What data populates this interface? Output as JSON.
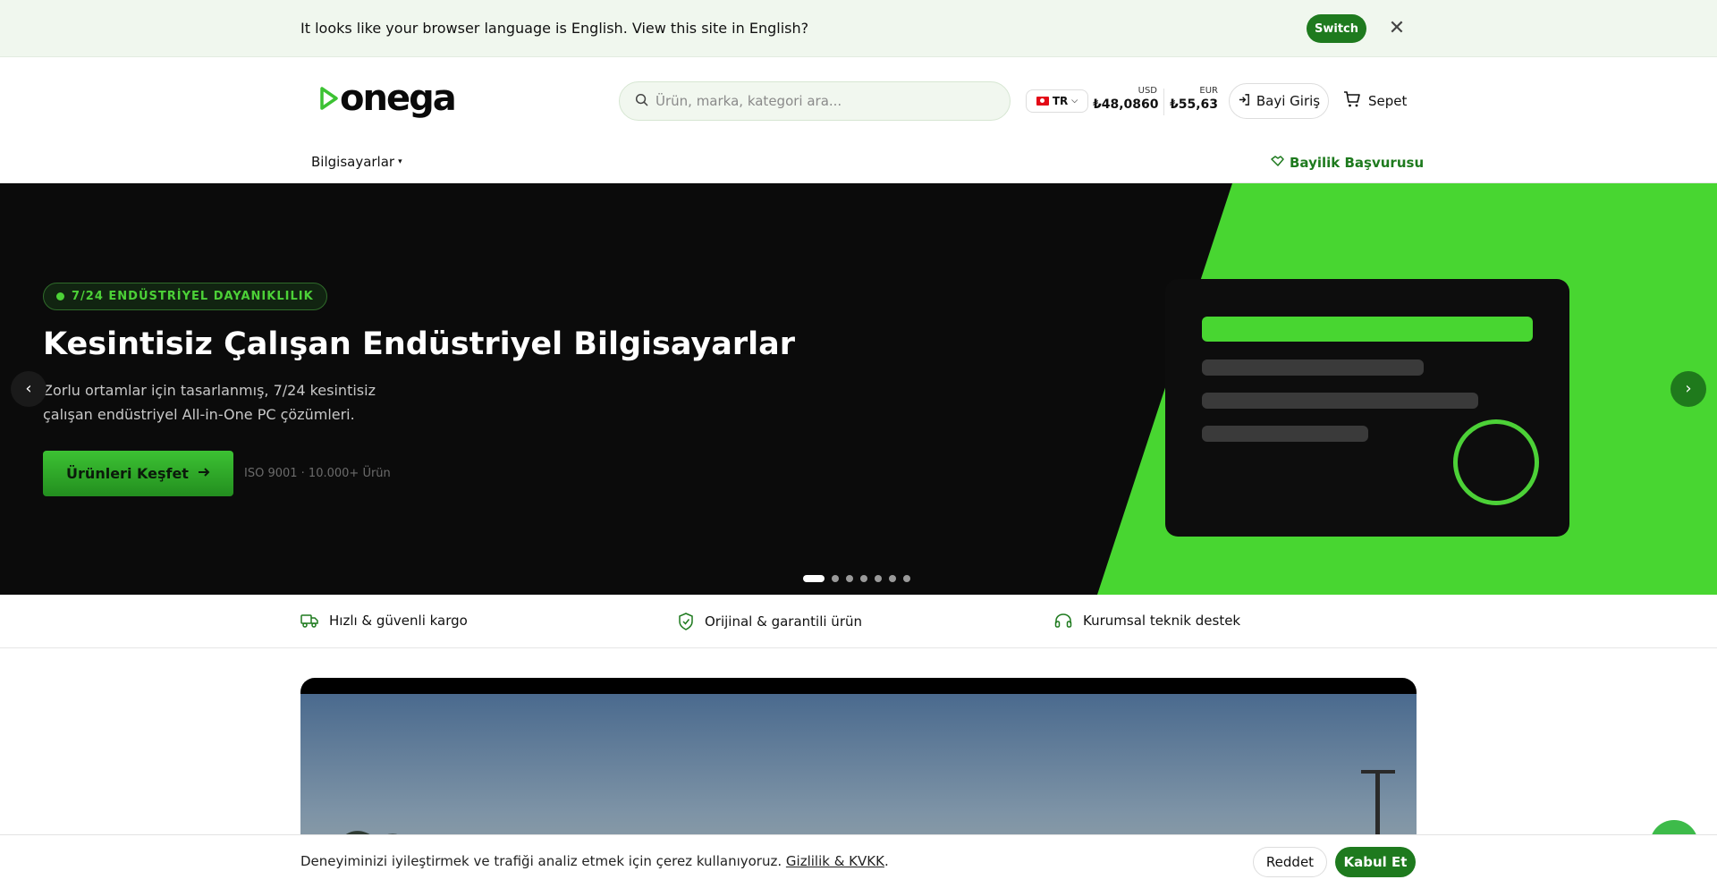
{
  "banner": {
    "text": "It looks like your browser language is English. View this site in English?",
    "switch_label": "Switch",
    "close_icon": "close-icon"
  },
  "header": {
    "logo_text": "onega",
    "search_placeholder": "Ürün, marka, kategori ara...",
    "language": "TR",
    "rates": {
      "usd_label": "USD",
      "usd_value": "₺48,0860",
      "eur_label": "EUR",
      "eur_value": "₺55,63"
    },
    "dealer_login": "Bayi Giriş",
    "cart": "Sepet",
    "nav_computers": "Bilgisayarlar",
    "dealer_apply": "Bayilik Başvurusu"
  },
  "hero": {
    "badge": "7/24 ENDÜSTRİYEL DAYANIKLILIK",
    "title": "Kesintisiz Çalışan Endüstriyel Bilgisayarlar",
    "subtitle": "Zorlu ortamlar için tasarlanmış, 7/24 kesintisiz çalışan endüstriyel All-in-One PC çözümleri.",
    "cta": "Ürünleri Keşfet",
    "meta": "ISO 9001 · 10.000+ Ürün",
    "slide_count": 7,
    "active_slide": 1,
    "accent_color": "#4cd137"
  },
  "features": [
    {
      "icon": "truck-icon",
      "label": "Hızlı & güvenli kargo"
    },
    {
      "icon": "shield-check-icon",
      "label": "Orijinal & garantili ürün"
    },
    {
      "icon": "headset-icon",
      "label": "Kurumsal teknik destek"
    }
  ],
  "cookie": {
    "text": "Deneyiminizi iyileştirmek ve trafiği analiz etmek için çerez kullanıyoruz.",
    "link": "Gizlilik & KVKK",
    "suffix": ".",
    "reject": "Reddet",
    "accept": "Kabul Et"
  },
  "colors": {
    "brand_green": "#1e7a1e",
    "hero_green": "#4cd137",
    "banner_bg": "#f0f7ee"
  }
}
